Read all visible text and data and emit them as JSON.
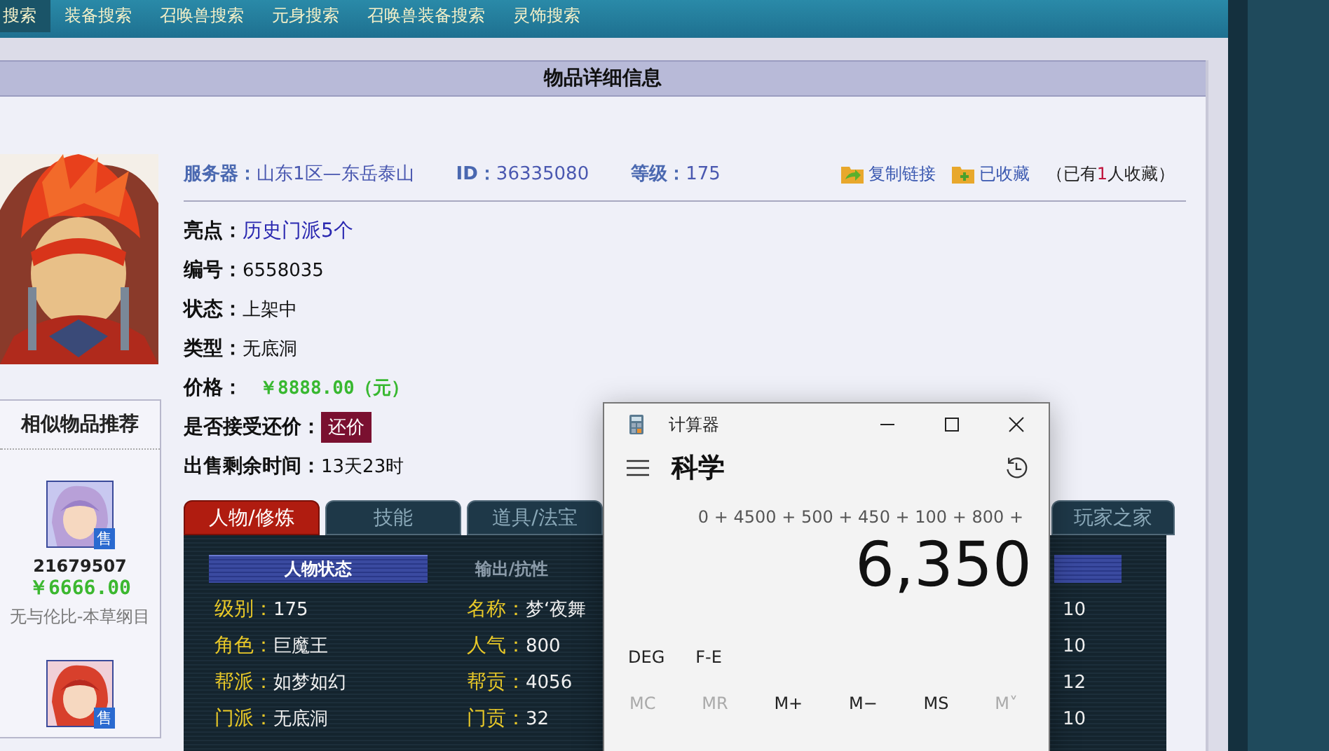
{
  "nav": [
    {
      "label": "搜索",
      "selected": true
    },
    {
      "label": "装备搜索",
      "selected": false
    },
    {
      "label": "召唤兽搜索",
      "selected": false
    },
    {
      "label": "元身搜索",
      "selected": false
    },
    {
      "label": "召唤兽装备搜索",
      "selected": false
    },
    {
      "label": "灵饰搜索",
      "selected": false
    }
  ],
  "panel_title": "物品详细信息",
  "header": {
    "server_label": "服务器：",
    "server": "山东1区—东岳泰山",
    "id_label": "ID：",
    "id": "36335080",
    "level_label": "等级：",
    "level": "175",
    "copy_link": "复制链接",
    "favorited": "已收藏",
    "favorites": {
      "prefix": "（已有",
      "count": "1",
      "suffix": "人收藏）"
    }
  },
  "info": [
    {
      "kind": "link",
      "label": "亮点：",
      "value": "历史门派5个"
    },
    {
      "kind": "text",
      "label": "编号：",
      "value": "6558035"
    },
    {
      "kind": "text",
      "label": "状态：",
      "value": "上架中"
    },
    {
      "kind": "text",
      "label": "类型：",
      "value": "无底洞"
    },
    {
      "kind": "price",
      "label": "价格：",
      "value": "￥8888.00（元）"
    },
    {
      "kind": "button",
      "label": "是否接受还价：",
      "value": "还价"
    },
    {
      "kind": "text",
      "label": "出售剩余时间：",
      "value": "13天23时"
    }
  ],
  "similar": {
    "title": "相似物品推荐",
    "items": [
      {
        "badge": "售",
        "number": "21679507",
        "price": "￥6666.00",
        "name": "无与伦比-本草纲目"
      },
      {
        "badge": "售"
      }
    ]
  },
  "tabs": [
    {
      "label": "人物/修炼",
      "selected": true
    },
    {
      "label": "技能",
      "selected": false
    },
    {
      "label": "道具/法宝",
      "selected": false
    },
    {
      "label": "玩家之家",
      "selected": false
    }
  ],
  "subtabs": [
    {
      "label": "人物状态",
      "selected": true
    },
    {
      "label": "输出/抗性",
      "selected": false
    }
  ],
  "stats": [
    [
      {
        "label": "级别：",
        "value": "175"
      },
      {
        "label": "名称：",
        "value": "梦‘夜舞"
      },
      {
        "value": "10"
      }
    ],
    [
      {
        "label": "角色：",
        "value": "巨魔王"
      },
      {
        "label": "人气：",
        "value": "800"
      },
      {
        "value": "10"
      }
    ],
    [
      {
        "label": "帮派：",
        "value": "如梦如幻"
      },
      {
        "label": "帮贡：",
        "value": "4056"
      },
      {
        "value": "12"
      }
    ],
    [
      {
        "label": "门派：",
        "value": "无底洞"
      },
      {
        "label": "门贡：",
        "value": "32"
      },
      {
        "value": "10"
      }
    ]
  ],
  "calculator": {
    "title": "计算器",
    "mode": "科学",
    "expression": "0 + 4500 + 500 + 450 + 100 + 800 +",
    "result": "6,350",
    "options": [
      "DEG",
      "F-E"
    ],
    "memory": [
      {
        "label": "MC",
        "disabled": true
      },
      {
        "label": "MR",
        "disabled": true
      },
      {
        "label": "M+",
        "disabled": false
      },
      {
        "label": "M−",
        "disabled": false
      },
      {
        "label": "MS",
        "disabled": false
      },
      {
        "label": "M˅",
        "disabled": true
      }
    ]
  }
}
